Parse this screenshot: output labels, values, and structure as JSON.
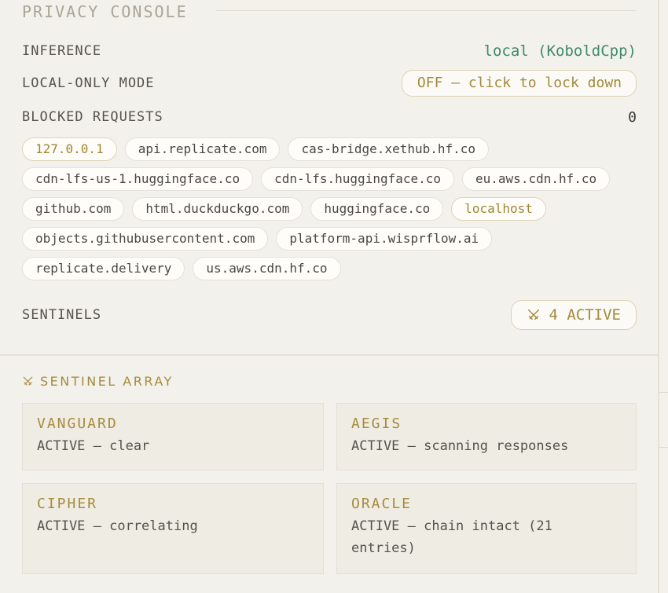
{
  "console": {
    "title": "PRIVACY CONSOLE"
  },
  "inference": {
    "label": "INFERENCE",
    "value": "local (KoboldCpp)"
  },
  "local_only": {
    "label": "LOCAL-ONLY MODE",
    "button_label": "OFF — click to lock down"
  },
  "blocked": {
    "label": "BLOCKED REQUESTS",
    "count": "0",
    "hosts": [
      "127.0.0.1",
      "api.replicate.com",
      "cas-bridge.xethub.hf.co",
      "cdn-lfs-us-1.huggingface.co",
      "cdn-lfs.huggingface.co",
      "eu.aws.cdn.hf.co",
      "github.com",
      "html.duckduckgo.com",
      "huggingface.co",
      "localhost",
      "objects.githubusercontent.com",
      "platform-api.wisprflow.ai",
      "replicate.delivery",
      "us.aws.cdn.hf.co"
    ],
    "highlighted_hosts": [
      "127.0.0.1",
      "localhost"
    ]
  },
  "sentinels": {
    "label": "SENTINELS",
    "badge": "4 ACTIVE",
    "badge_icon": "crossed-swords-icon"
  },
  "sentinel_array": {
    "heading": "SENTINEL ARRAY",
    "heading_icon": "crossed-swords-icon",
    "cards": [
      {
        "name": "VANGUARD",
        "status": "ACTIVE — clear"
      },
      {
        "name": "AEGIS",
        "status": "ACTIVE — scanning responses"
      },
      {
        "name": "CIPHER",
        "status": "ACTIVE — correlating"
      },
      {
        "name": "ORACLE",
        "status": "ACTIVE — chain intact (21 entries)"
      }
    ]
  },
  "colors": {
    "background": "#f3f1eb",
    "accent_gold": "#a68b3d",
    "inference_green": "#3f8a6b",
    "card_background": "#efece4"
  }
}
